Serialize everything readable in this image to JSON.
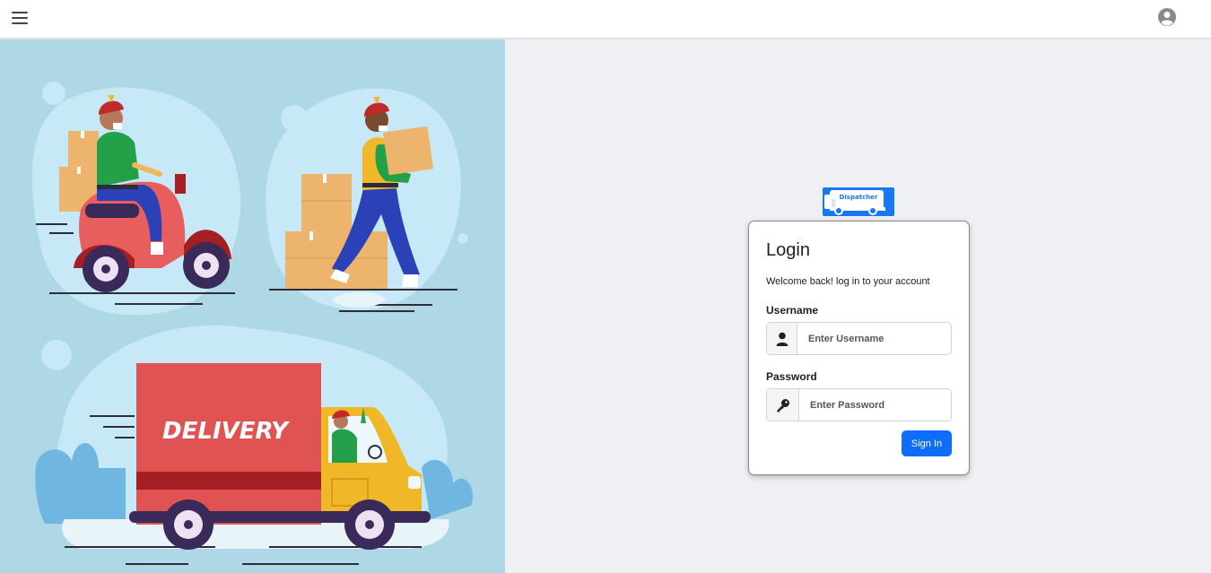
{
  "topbar": {
    "menu_icon": "hamburger-menu-icon",
    "profile_icon": "user-circle-icon"
  },
  "illustration": {
    "truck_text": "DELIVERY"
  },
  "logo": {
    "text": "Dispatcher",
    "color": "#1877f2"
  },
  "login": {
    "title": "Login",
    "subtitle": "Welcome back! log in to your account",
    "username_label": "Username",
    "username_placeholder": "Enter Username",
    "username_value": "",
    "password_label": "Password",
    "password_placeholder": "Enter Password",
    "password_value": "",
    "submit_label": "Sign In",
    "user_icon": "user-icon",
    "key_icon": "key-icon"
  },
  "colors": {
    "accent": "#0d6efd",
    "illustration_bg": "#aed8e6",
    "page_bg": "#eff0f4"
  }
}
